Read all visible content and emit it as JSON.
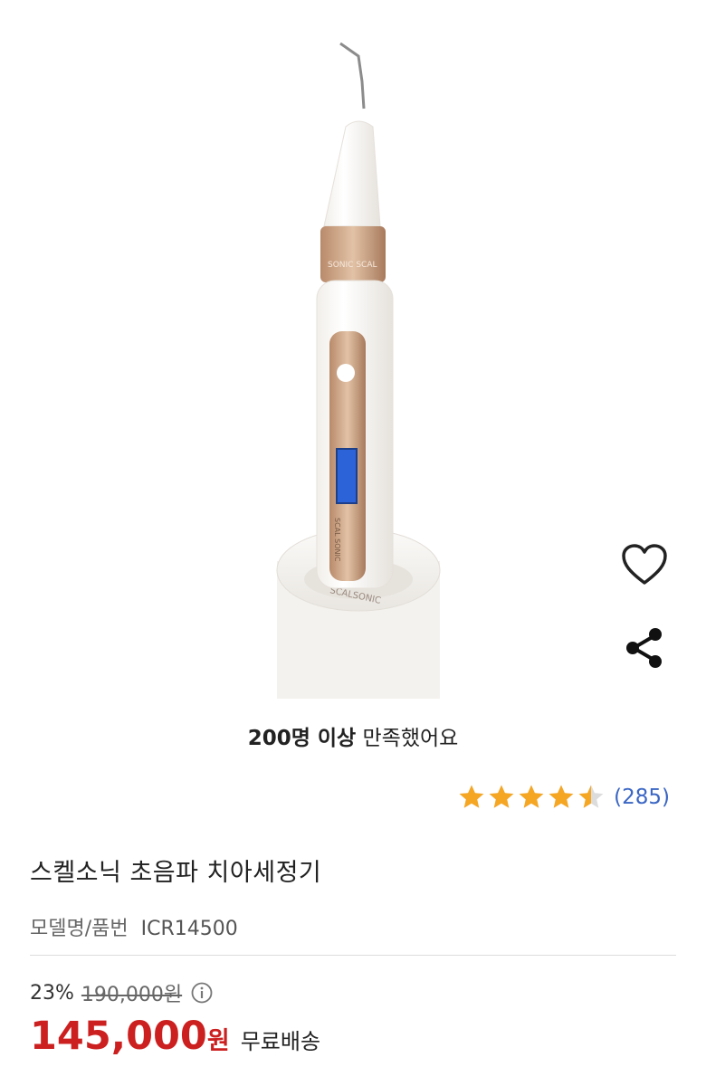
{
  "product": {
    "image_name": "ultrasonic-tooth-scaler-product-image",
    "logo_text_stand": "SCALSONIC",
    "logo_text_handle": "SCAL SONIC",
    "logo_text_ring": "SONIC SCAL",
    "title": "스켈소닉 초음파 치아세정기",
    "model_label": "모델명/품번",
    "model_value": "ICR14500"
  },
  "actions": {
    "wishlist_icon": "heart-outline-icon",
    "share_icon": "share-icon"
  },
  "satisfaction": {
    "strong": "200명 이상",
    "rest": " 만족했어요"
  },
  "rating": {
    "stars": 4.5,
    "max_stars": 5,
    "count": "(285)",
    "star_color": "#F5A623"
  },
  "pricing": {
    "discount": "23%",
    "original_price": "190,000원",
    "info_icon": "info-circle-icon",
    "price": "145,000",
    "currency": "원",
    "shipping": "무료배송",
    "price_color": "#CC1F1F"
  }
}
